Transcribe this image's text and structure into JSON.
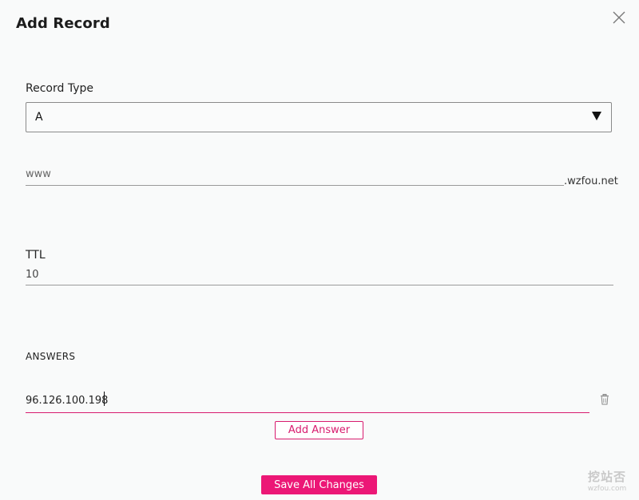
{
  "dialog": {
    "title": "Add Record"
  },
  "record_type": {
    "label": "Record Type",
    "selected": "A"
  },
  "name": {
    "placeholder": "www",
    "suffix": ".wzfou.net"
  },
  "ttl": {
    "label": "TTL",
    "value": "10"
  },
  "answers": {
    "label": "ANSWERS",
    "items": [
      {
        "value": "96.126.100.198"
      }
    ],
    "add_label": "Add Answer"
  },
  "footer": {
    "save_label": "Save All Changes"
  },
  "watermark": {
    "main": "挖站否",
    "sub": "wzfou.com"
  },
  "colors": {
    "accent": "#ec1776",
    "accent_border": "#d81b6e",
    "background": "#f9fafa"
  },
  "icons": {
    "close": "close-icon",
    "dropdown": "caret-down-icon",
    "delete_answer": "trash-icon"
  }
}
